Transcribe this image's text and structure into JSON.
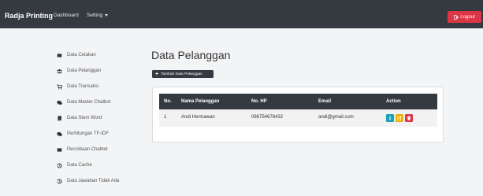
{
  "navbar": {
    "brand": "Radja Printing",
    "links": {
      "dashboard": "Dashboard",
      "setting": "Setting"
    },
    "logout": "Logout",
    "bg_color": "#343a40",
    "logout_color": "#dc3545"
  },
  "sidebar": {
    "items": [
      {
        "label": "Data Cetakan",
        "icon": "square-icon"
      },
      {
        "label": "Data Pelanggan",
        "icon": "users-icon"
      },
      {
        "label": "Data Transaksi",
        "icon": "shopping-cart-icon"
      },
      {
        "label": "Data Master Chatbot",
        "icon": "comments-icon"
      },
      {
        "label": "Data Stem Word",
        "icon": "book-icon"
      },
      {
        "label": "Perhitungan TF-IDF",
        "icon": "comments-icon"
      },
      {
        "label": "Percobaan Chatbot",
        "icon": "square-icon"
      },
      {
        "label": "Data Cache",
        "icon": "history-icon"
      },
      {
        "label": "Data Jawaban Tidak Ada",
        "icon": "history-icon"
      }
    ]
  },
  "main": {
    "title": "Data Pelanggan",
    "add_button": "Tambah Data Pelanggan",
    "table": {
      "headers": [
        "No.",
        "Nama Pelanggan",
        "No. HP",
        "Email",
        "Action"
      ],
      "rows": [
        {
          "no": "1",
          "name": "Andi Hermawan",
          "phone": "086754678432",
          "email": "andi@gmail.com"
        }
      ]
    }
  },
  "colors": {
    "info": "#17a2b8",
    "warning": "#f0ad00",
    "danger": "#dc3545"
  }
}
